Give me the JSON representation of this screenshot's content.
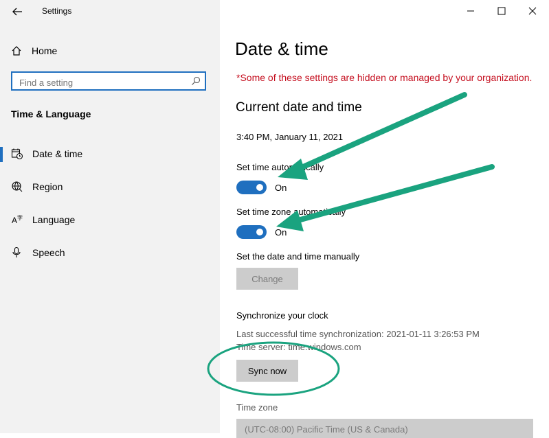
{
  "window": {
    "title": "Settings"
  },
  "sidebar": {
    "home_label": "Home",
    "search_placeholder": "Find a setting",
    "section_title": "Time & Language",
    "items": [
      {
        "label": "Date & time",
        "icon": "calendar-clock-icon",
        "active": true
      },
      {
        "label": "Region",
        "icon": "globe-icon",
        "active": false
      },
      {
        "label": "Language",
        "icon": "language-icon",
        "active": false
      },
      {
        "label": "Speech",
        "icon": "microphone-icon",
        "active": false
      }
    ]
  },
  "main": {
    "title": "Date & time",
    "notice": "*Some of these settings are hidden or managed by your organization.",
    "section_title": "Current date and time",
    "current_datetime": "3:40 PM, January 11, 2021",
    "auto_time": {
      "label": "Set time automatically",
      "state": "On"
    },
    "auto_timezone": {
      "label": "Set time zone automatically",
      "state": "On"
    },
    "manual": {
      "label": "Set the date and time manually",
      "button": "Change"
    },
    "sync": {
      "title": "Synchronize your clock",
      "last_sync": "Last successful time synchronization: 2021-01-11 3:26:53 PM",
      "server": "Time server: time.windows.com",
      "button": "Sync now"
    },
    "timezone": {
      "label": "Time zone",
      "value": "(UTC-08:00) Pacific Time (US & Canada)"
    }
  },
  "colors": {
    "accent": "#1f6fbf",
    "annotation": "#1aa37f",
    "notice": "#c50f1f"
  }
}
